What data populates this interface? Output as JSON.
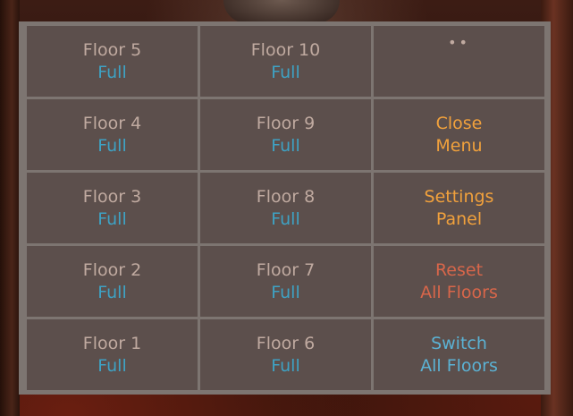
{
  "menu": {
    "column1": [
      {
        "label": "Floor 5",
        "status": "Full"
      },
      {
        "label": "Floor 4",
        "status": "Full"
      },
      {
        "label": "Floor 3",
        "status": "Full"
      },
      {
        "label": "Floor 2",
        "status": "Full"
      },
      {
        "label": "Floor 1",
        "status": "Full"
      }
    ],
    "column2": [
      {
        "label": "Floor 10",
        "status": "Full"
      },
      {
        "label": "Floor 9",
        "status": "Full"
      },
      {
        "label": "Floor 8",
        "status": "Full"
      },
      {
        "label": "Floor 7",
        "status": "Full"
      },
      {
        "label": "Floor 6",
        "status": "Full"
      }
    ],
    "more_indicator": "••",
    "close": {
      "line1": "Close",
      "line2": "Menu"
    },
    "settings": {
      "line1": "Settings",
      "line2": "Panel"
    },
    "reset": {
      "line1": "Reset",
      "line2": "All Floors"
    },
    "switch": {
      "line1": "Switch",
      "line2": "All Floors"
    }
  },
  "colors": {
    "panel_border": "#7d7571",
    "cell_bg": "#5c4f4c",
    "floor_label": "#c0aaa0",
    "status": "#3ea2c4",
    "action_orange": "#f1a13c",
    "action_red": "#d8664a",
    "action_cyan": "#5bb2d4"
  }
}
